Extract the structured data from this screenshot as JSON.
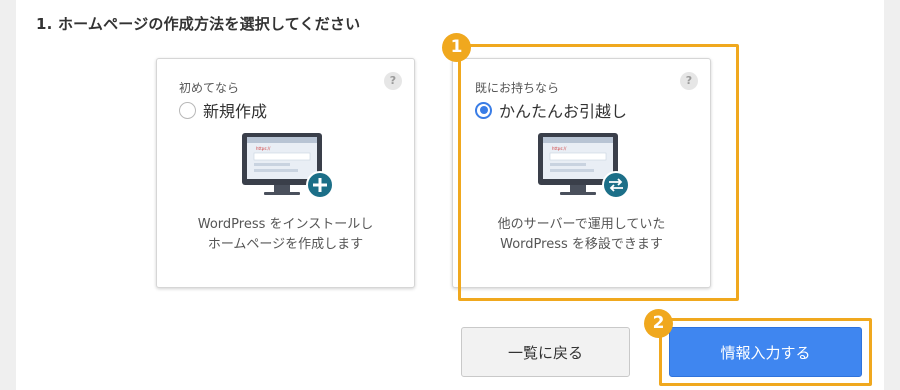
{
  "section_title": "1. ホームページの作成方法を選択してください",
  "options": [
    {
      "subtitle": "初めてなら",
      "label": "新規作成",
      "selected": false,
      "description_line1": "WordPress をインストールし",
      "description_line2": "ホームページを作成します",
      "illustration_icon": "plus-icon",
      "screen_url_text": "https://"
    },
    {
      "subtitle": "既にお持ちなら",
      "label": "かんたんお引越し",
      "selected": true,
      "description_line1": "他のサーバーで運用していた",
      "description_line2": "WordPress を移設できます",
      "illustration_icon": "transfer-arrows-icon",
      "screen_url_text": "https://"
    }
  ],
  "help_glyph": "?",
  "buttons": {
    "back_label": "一覧に戻る",
    "next_label": "情報入力する"
  },
  "step_markers": [
    "1",
    "2"
  ],
  "colors": {
    "accent": "#3f86f0",
    "highlight": "#f0a81e",
    "illustration_badge": "#1c6f88",
    "monitor_frame": "#3a3f4a"
  }
}
